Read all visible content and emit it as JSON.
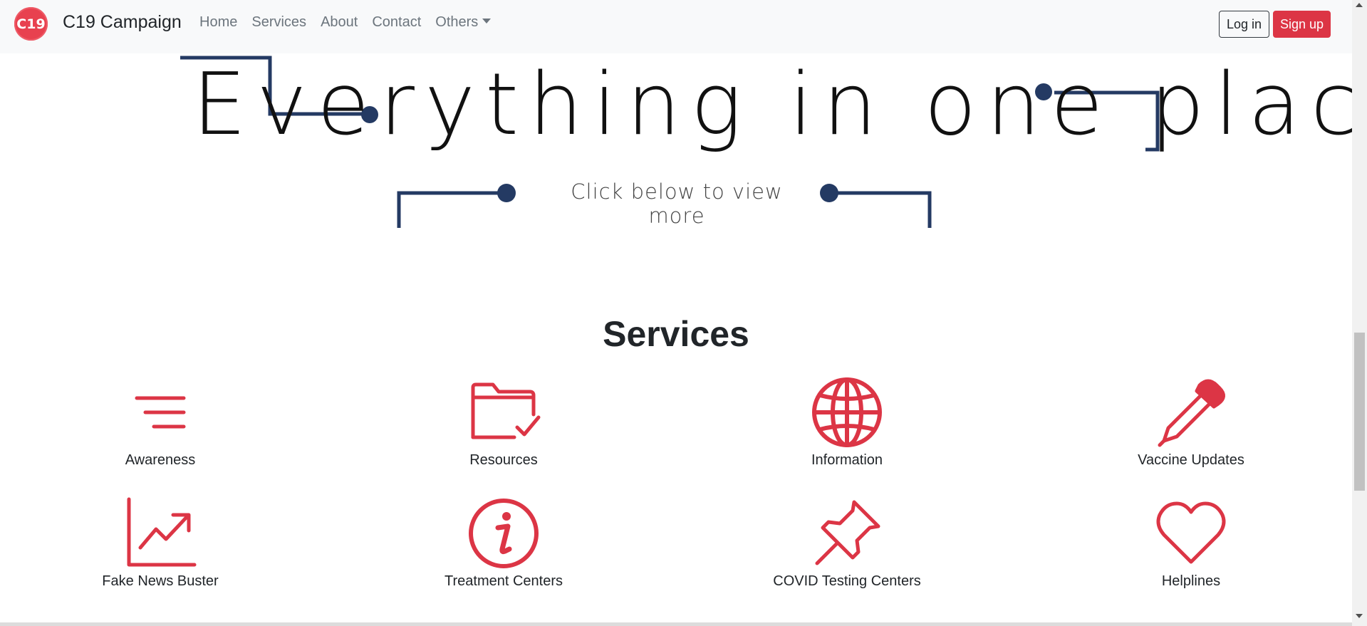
{
  "navbar": {
    "logo_text": "C19",
    "brand": "C19 Campaign",
    "links": [
      "Home",
      "Services",
      "About",
      "Contact",
      "Others"
    ],
    "login_label": "Log in",
    "signup_label": "Sign up"
  },
  "hero": {
    "title": "Everything in one place",
    "subtitle": "Click below to view more"
  },
  "services": {
    "heading": "Services",
    "items": [
      {
        "label": "Awareness",
        "icon": "filter-lines-icon"
      },
      {
        "label": "Resources",
        "icon": "folder-check-icon"
      },
      {
        "label": "Information",
        "icon": "globe-icon"
      },
      {
        "label": "Vaccine Updates",
        "icon": "dropper-icon"
      },
      {
        "label": "Fake News Buster",
        "icon": "trending-chart-icon"
      },
      {
        "label": "Treatment Centers",
        "icon": "info-circle-icon"
      },
      {
        "label": "COVID Testing Centers",
        "icon": "pushpin-icon"
      },
      {
        "label": "Helplines",
        "icon": "heart-icon"
      }
    ]
  },
  "colors": {
    "accent": "#dc3545",
    "navy": "#243a63",
    "navbar_bg": "#f8f9fa"
  }
}
